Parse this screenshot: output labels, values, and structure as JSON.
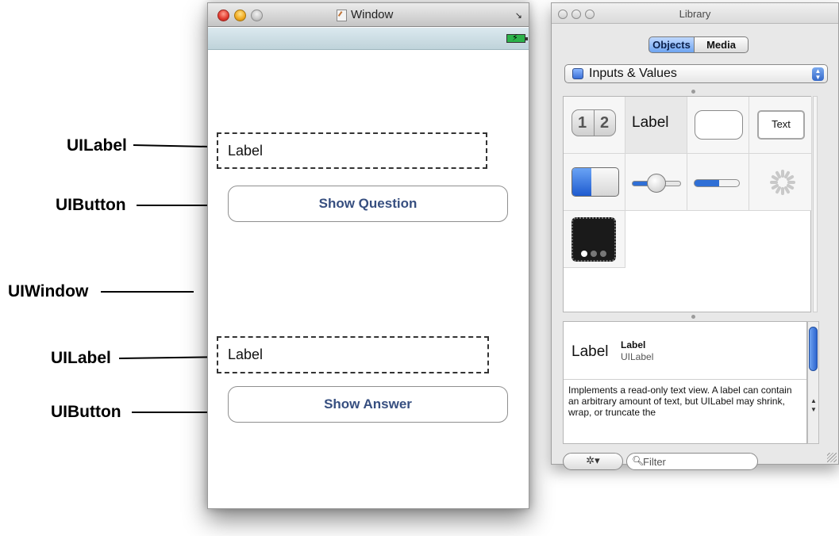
{
  "annotations": {
    "label_top": "UILabel",
    "button_top": "UIButton",
    "window": "UIWindow",
    "label_bottom": "UILabel",
    "button_bottom": "UIButton"
  },
  "ib_window": {
    "title": "Window",
    "label_top_text": "Label",
    "button_top_text": "Show Question",
    "label_bottom_text": "Label",
    "button_bottom_text": "Show Answer"
  },
  "library": {
    "title": "Library",
    "tabs": [
      "Objects",
      "Media"
    ],
    "selected_tab": "Objects",
    "category": "Inputs & Values",
    "items": [
      {
        "name": "segmented-control",
        "glyphs": [
          "1",
          "2"
        ]
      },
      {
        "name": "label",
        "text": "Label"
      },
      {
        "name": "round-rect-button"
      },
      {
        "name": "text-field",
        "text": "Text"
      },
      {
        "name": "switch"
      },
      {
        "name": "slider"
      },
      {
        "name": "progress-view"
      },
      {
        "name": "activity-indicator"
      },
      {
        "name": "page-control"
      }
    ],
    "detail": {
      "big_label": "Label",
      "name": "Label",
      "class": "UILabel",
      "description": "Implements a read-only text view. A label can contain an arbitrary amount of text, but UILabel may shrink, wrap, or truncate the"
    },
    "filter_placeholder": "Filter",
    "action_icon": "gear-icon"
  },
  "colors": {
    "button_text": "#374f80",
    "selection_blue": "#3a6fd6"
  }
}
